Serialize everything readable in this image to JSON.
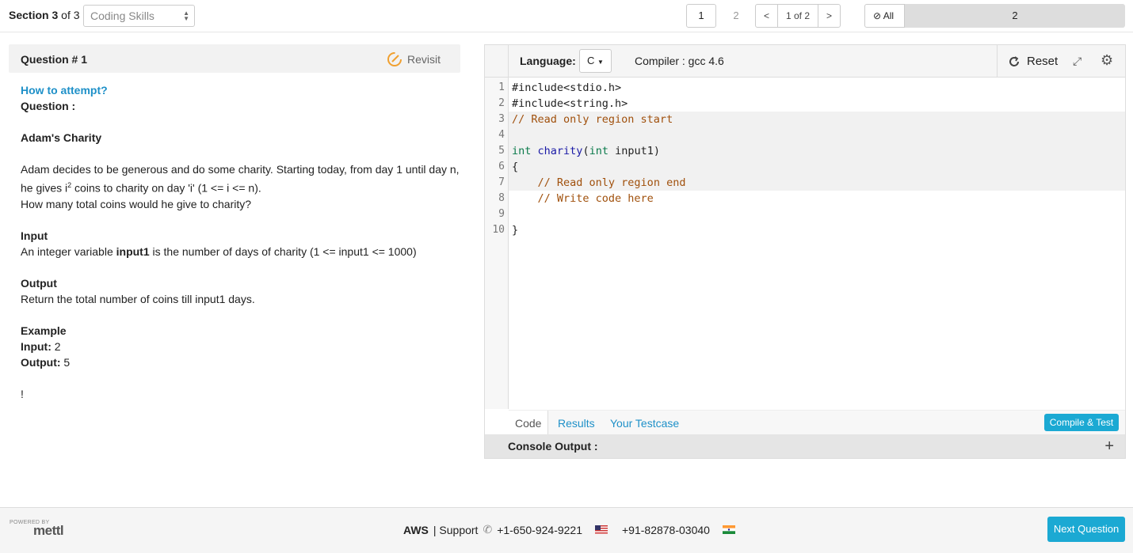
{
  "header": {
    "section_prefix": "Section",
    "section_current": "3",
    "section_of": "of 3",
    "section_select": "Coding Skills",
    "page_buttons": [
      "1",
      "2"
    ],
    "pager_prev": "<",
    "pager_label": "1 of 2",
    "pager_next": ">",
    "filter_all": "All",
    "progress_label": "2"
  },
  "question": {
    "title": "Question # 1",
    "revisit_label": "Revisit",
    "how_to": "How to attempt?",
    "question_label": "Question :",
    "problem_title": "Adam's Charity",
    "desc_1a": "Adam decides to be generous and do some charity. Starting today, from day 1 until day n, he gives i",
    "desc_1sup": "2",
    "desc_1b": " coins to charity on day 'i' (1 <= i <= n).",
    "desc_2": "How many total coins would he give to charity?",
    "input_heading": "Input",
    "input_text_a": "An integer variable ",
    "input_text_var": "input1",
    "input_text_b": " is the number of days of charity (1 <= input1 <= 1000)",
    "output_heading": "Output",
    "output_text": "Return the total number of coins till input1 days.",
    "example_heading": "Example",
    "example_input_label": "Input:",
    "example_input_value": " 2",
    "example_output_label": "Output:",
    "example_output_value": " 5",
    "trailing": "!"
  },
  "editor": {
    "language_label": "Language:",
    "language_value": "C",
    "compiler": "Compiler : gcc 4.6",
    "reset_label": "Reset",
    "code_lines": [
      {
        "n": "1",
        "text": "#include<stdio.h>"
      },
      {
        "n": "2",
        "text": "#include<string.h>"
      },
      {
        "n": "3",
        "text": "// Read only region start"
      },
      {
        "n": "4",
        "text": ""
      },
      {
        "n": "5",
        "text": "int charity(int input1)"
      },
      {
        "n": "6",
        "text": "{"
      },
      {
        "n": "7",
        "text": "    // Read only region end"
      },
      {
        "n": "8",
        "text": "    // Write code here"
      },
      {
        "n": "9",
        "text": ""
      },
      {
        "n": "10",
        "text": "}"
      }
    ],
    "tabs": {
      "code": "Code",
      "results": "Results",
      "testcase": "Your Testcase"
    },
    "compile_button": "Compile & Test",
    "console_label": "Console Output :"
  },
  "footer": {
    "powered_by": "POWERED BY",
    "brand": "mettl",
    "aws": "AWS",
    "support": "| Support",
    "phone_us": "+1-650-924-9221",
    "phone_in": "+91-82878-03040",
    "next_button": "Next Question"
  },
  "colors": {
    "accent": "#1ba9d3",
    "link": "#1e90c8",
    "comment": "#a0500c"
  }
}
